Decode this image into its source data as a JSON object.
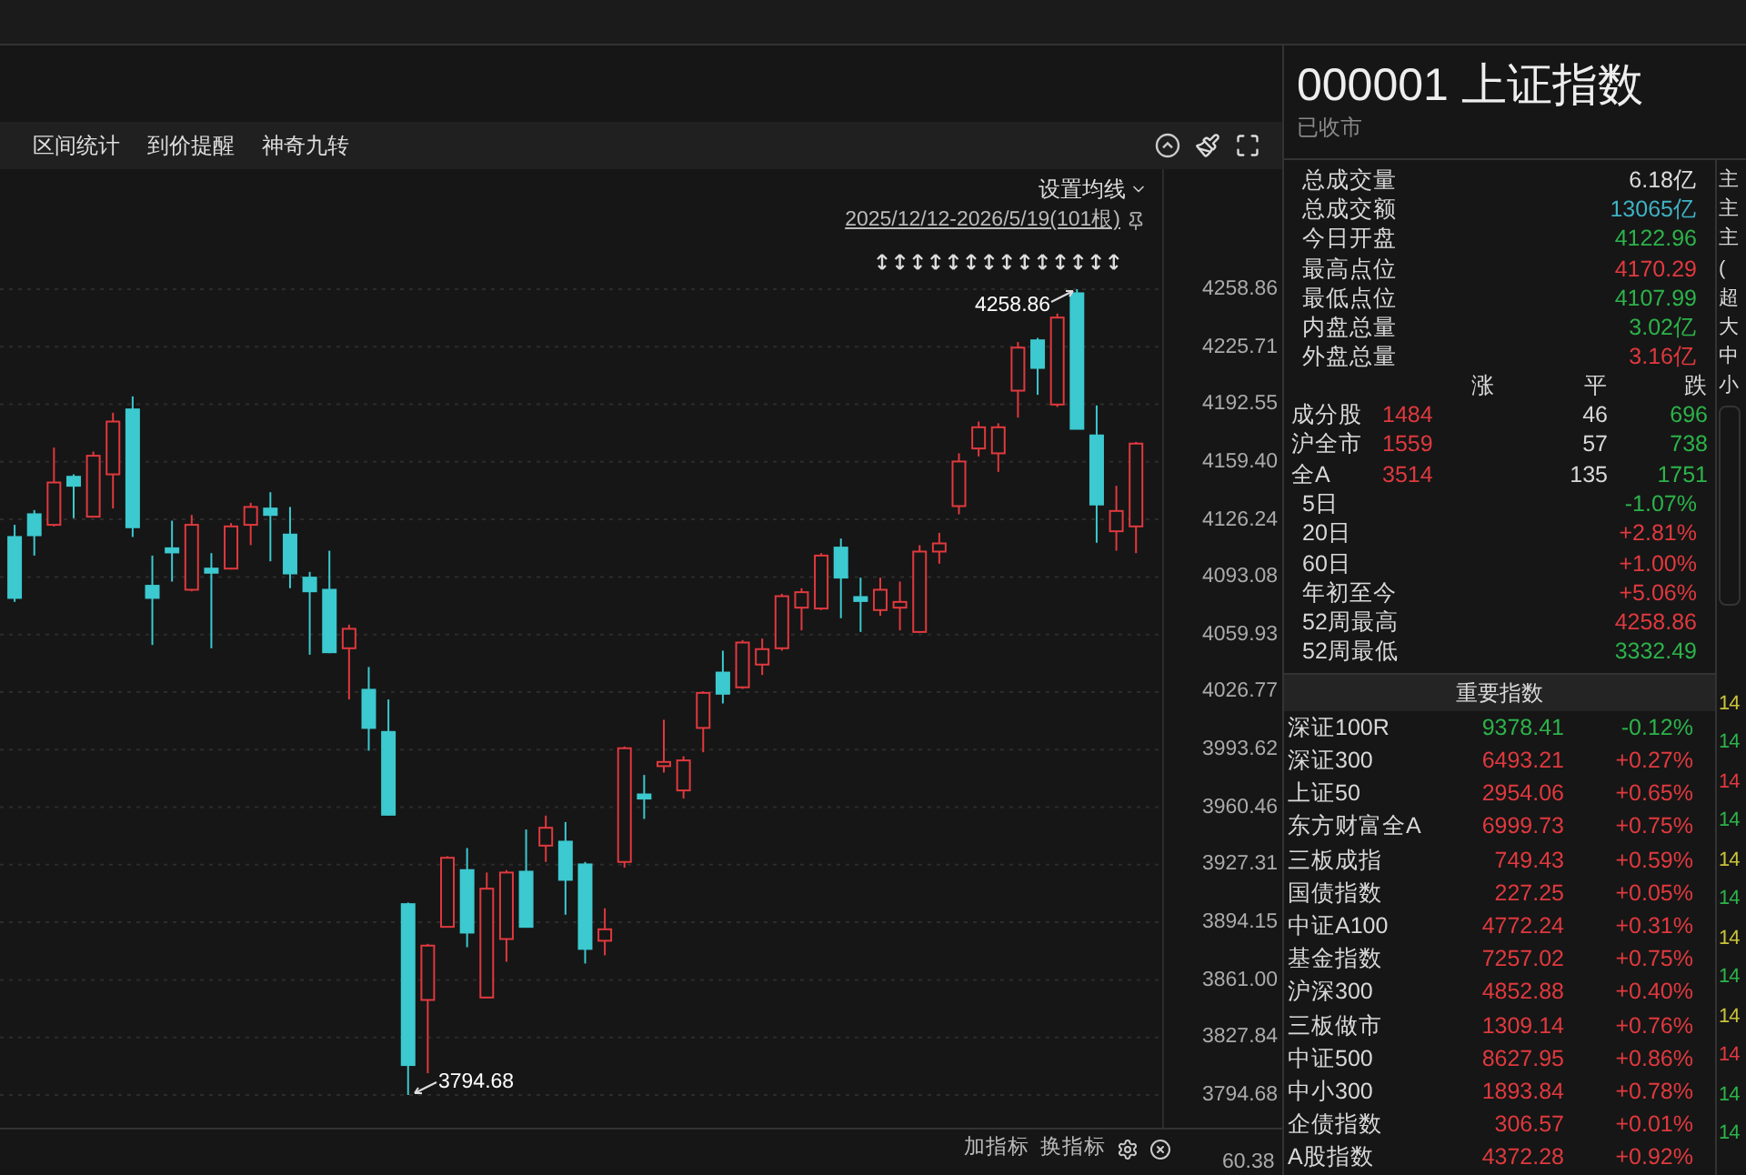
{
  "toolbar": {
    "items": [
      "区间统计",
      "到价提醒",
      "神奇九转"
    ]
  },
  "chart": {
    "ma_setting": "设置均线",
    "date_range": "2025/12/12-2026/5/19(101根)",
    "high_label": "4258.86",
    "low_label": "3794.68",
    "chart_data": {
      "type": "candlestick",
      "ylim": [
        3775.8,
        4328.0
      ],
      "grid": true,
      "yticks": [
        {
          "value": 4258.86,
          "label": "4258.86"
        },
        {
          "value": 4225.71,
          "label": "4225.71"
        },
        {
          "value": 4192.55,
          "label": "4192.55"
        },
        {
          "value": 4159.4,
          "label": "4159.40"
        },
        {
          "value": 4126.24,
          "label": "4126.24"
        },
        {
          "value": 4093.08,
          "label": "4093.08"
        },
        {
          "value": 4059.93,
          "label": "4059.93"
        },
        {
          "value": 4026.77,
          "label": "4026.77"
        },
        {
          "value": 3993.62,
          "label": "3993.62"
        },
        {
          "value": 3960.46,
          "label": "3960.46"
        },
        {
          "value": 3927.31,
          "label": "3927.31"
        },
        {
          "value": 3894.15,
          "label": "3894.15"
        },
        {
          "value": 3861.0,
          "label": "3861.00"
        },
        {
          "value": 3827.84,
          "label": "3827.84"
        },
        {
          "value": 3794.68,
          "label": "3794.68"
        }
      ],
      "ohlc": [
        [
          4116.1,
          4123.1,
          4078.7,
          4081.0
        ],
        [
          4129.2,
          4131.6,
          4105.4,
          4117.1
        ],
        [
          4123.1,
          4167.6,
          4122.2,
          4147.5
        ],
        [
          4150.8,
          4152.2,
          4126.9,
          4145.6
        ],
        [
          4127.8,
          4165.3,
          4127.8,
          4162.9
        ],
        [
          4152.2,
          4187.7,
          4132.5,
          4182.6
        ],
        [
          4189.6,
          4197.1,
          4116.1,
          4121.7
        ],
        [
          4088.0,
          4105.4,
          4053.9,
          4081.0
        ],
        [
          4109.6,
          4125.5,
          4090.4,
          4107.2
        ],
        [
          4085.7,
          4128.8,
          4084.8,
          4123.1
        ],
        [
          4097.9,
          4106.8,
          4052.0,
          4095.5
        ],
        [
          4097.9,
          4124.1,
          4097.4,
          4122.2
        ],
        [
          4123.1,
          4135.8,
          4111.4,
          4133.4
        ],
        [
          4132.5,
          4141.9,
          4102.1,
          4128.8
        ],
        [
          4117.5,
          4133.4,
          4086.6,
          4095.1
        ],
        [
          4092.7,
          4096.0,
          4048.3,
          4084.8
        ],
        [
          4085.7,
          4108.2,
          4049.2,
          4049.7
        ],
        [
          4052.0,
          4065.6,
          4022.5,
          4063.2
        ],
        [
          4028.1,
          4041.2,
          3993.0,
          4006.1
        ],
        [
          4003.8,
          4022.5,
          3955.6,
          3956.1
        ],
        [
          3904.6,
          3905.5,
          3794.68,
          3811.9
        ],
        [
          3849.4,
          3881.7,
          3807.2,
          3880.7
        ],
        [
          3891.5,
          3932.2,
          3891.5,
          3931.3
        ],
        [
          3924.2,
          3936.9,
          3879.8,
          3888.2
        ],
        [
          3850.8,
          3922.8,
          3850.8,
          3913.5
        ],
        [
          3884.5,
          3924.2,
          3871.4,
          3922.8
        ],
        [
          3923.3,
          3947.6,
          3891.5,
          3891.5
        ],
        [
          3938.3,
          3955.6,
          3928.9,
          3948.6
        ],
        [
          3940.6,
          3951.9,
          3898.5,
          3918.6
        ],
        [
          3927.5,
          3928.9,
          3870.4,
          3878.8
        ],
        [
          3883.5,
          3902.2,
          3875.1,
          3890.1
        ],
        [
          3928.9,
          3995.4,
          3925.6,
          3994.4
        ],
        [
          3967.8,
          3979.0,
          3953.7,
          3965.4
        ],
        [
          3984.1,
          4010.8,
          3980.4,
          3986.5
        ],
        [
          3970.1,
          3989.8,
          3965.4,
          3987.4
        ],
        [
          4006.1,
          4027.2,
          3992.1,
          4026.3
        ],
        [
          4038.0,
          4050.6,
          4020.2,
          4025.8
        ],
        [
          4029.5,
          4056.7,
          4028.6,
          4055.3
        ],
        [
          4042.6,
          4057.6,
          4036.6,
          4051.5
        ],
        [
          4052.0,
          4083.4,
          4050.6,
          4082.0
        ],
        [
          4075.4,
          4086.6,
          4062.3,
          4084.3
        ],
        [
          4074.9,
          4106.8,
          4074.0,
          4105.4
        ],
        [
          4110.0,
          4115.2,
          4069.3,
          4092.7
        ],
        [
          4081.5,
          4092.7,
          4061.4,
          4079.2
        ],
        [
          4074.0,
          4092.7,
          4070.7,
          4085.7
        ],
        [
          4075.4,
          4090.4,
          4062.3,
          4078.7
        ],
        [
          4061.4,
          4111.4,
          4060.9,
          4107.7
        ],
        [
          4107.7,
          4118.5,
          4100.7,
          4112.4
        ],
        [
          4133.9,
          4164.3,
          4129.2,
          4159.6
        ],
        [
          4167.1,
          4182.6,
          4162.5,
          4179.3
        ],
        [
          4164.3,
          4181.6,
          4153.6,
          4179.3
        ],
        [
          4200.4,
          4228.4,
          4184.9,
          4225.2
        ],
        [
          4229.4,
          4230.8,
          4198.0,
          4213.5
        ],
        [
          4192.4,
          4244.8,
          4191.0,
          4242.5
        ],
        [
          4256.5,
          4258.86,
          4178.4,
          4178.4
        ],
        [
          4174.6,
          4191.9,
          4112.8,
          4134.8
        ],
        [
          4119.4,
          4145.6,
          4108.2,
          4131.1
        ],
        [
          4122.2,
          4170.9,
          4106.8,
          4169.9
        ]
      ]
    },
    "sub_axis_label": "60.38"
  },
  "indicator_bar": {
    "buttons": [
      "加指标",
      "换指标"
    ]
  },
  "quote": {
    "title": "000001 上证指数",
    "status": "已收市",
    "stats": [
      {
        "label": "总成交量",
        "value": "6.18亿",
        "color": "#dddddd"
      },
      {
        "label": "总成交额",
        "value": "13065亿",
        "color": "#3fb2c4"
      },
      {
        "label": "今日开盘",
        "value": "4122.96",
        "color": "#2cb34a"
      },
      {
        "label": "最高点位",
        "value": "4170.29",
        "color": "#e0393e"
      },
      {
        "label": "最低点位",
        "value": "4107.99",
        "color": "#2cb34a"
      },
      {
        "label": "内盘总量",
        "value": "3.02亿",
        "color": "#2cb34a"
      },
      {
        "label": "外盘总量",
        "value": "3.16亿",
        "color": "#e0393e"
      }
    ],
    "breadth_header": [
      "涨",
      "平",
      "跌"
    ],
    "breadth": [
      {
        "label": "成分股",
        "up": "1484",
        "flat": "46",
        "down": "696"
      },
      {
        "label": "沪全市",
        "up": "1559",
        "flat": "57",
        "down": "738"
      },
      {
        "label": "全A",
        "up": "3514",
        "flat": "135",
        "down": "1751"
      }
    ],
    "returns": [
      {
        "label": "5日",
        "value": "-1.07%",
        "color": "#2cb34a"
      },
      {
        "label": "20日",
        "value": "+2.81%",
        "color": "#e0393e"
      },
      {
        "label": "60日",
        "value": "+1.00%",
        "color": "#e0393e"
      },
      {
        "label": "年初至今",
        "value": "+5.06%",
        "color": "#e0393e"
      },
      {
        "label": "52周最高",
        "value": "4258.86",
        "color": "#e0393e"
      },
      {
        "label": "52周最低",
        "value": "3332.49",
        "color": "#2cb34a"
      }
    ]
  },
  "important_indices": {
    "title": "重要指数",
    "rows": [
      {
        "name": "深证100R",
        "price": "9378.41",
        "change": "-0.12%",
        "color": "#2cb34a"
      },
      {
        "name": "深证300",
        "price": "6493.21",
        "change": "+0.27%",
        "color": "#e0393e"
      },
      {
        "name": "上证50",
        "price": "2954.06",
        "change": "+0.65%",
        "color": "#e0393e"
      },
      {
        "name": "东方财富全A",
        "price": "6999.73",
        "change": "+0.75%",
        "color": "#e0393e"
      },
      {
        "name": "三板成指",
        "price": "749.43",
        "change": "+0.59%",
        "color": "#e0393e"
      },
      {
        "name": "国债指数",
        "price": "227.25",
        "change": "+0.05%",
        "color": "#e0393e"
      },
      {
        "name": "中证A100",
        "price": "4772.24",
        "change": "+0.31%",
        "color": "#e0393e"
      },
      {
        "name": "基金指数",
        "price": "7257.02",
        "change": "+0.75%",
        "color": "#e0393e"
      },
      {
        "name": "沪深300",
        "price": "4852.88",
        "change": "+0.40%",
        "color": "#e0393e"
      },
      {
        "name": "三板做市",
        "price": "1309.14",
        "change": "+0.76%",
        "color": "#e0393e"
      },
      {
        "name": "中证500",
        "price": "8627.95",
        "change": "+0.86%",
        "color": "#e0393e"
      },
      {
        "name": "中小300",
        "price": "1893.84",
        "change": "+0.78%",
        "color": "#e0393e"
      },
      {
        "name": "企债指数",
        "price": "306.57",
        "change": "+0.01%",
        "color": "#e0393e"
      },
      {
        "name": "A股指数",
        "price": "4372.28",
        "change": "+0.92%",
        "color": "#e0393e"
      }
    ]
  },
  "side_panel": {
    "labels": [
      "主",
      "主",
      "主",
      "(",
      "超",
      "大",
      "中",
      "小"
    ],
    "values": [
      {
        "text": "14",
        "color": "#c9c23a"
      },
      {
        "text": "14",
        "color": "#2cb34a"
      },
      {
        "text": "14",
        "color": "#e0393e"
      },
      {
        "text": "14",
        "color": "#2cb34a"
      },
      {
        "text": "14",
        "color": "#c9c23a"
      },
      {
        "text": "14",
        "color": "#2cb34a"
      },
      {
        "text": "14",
        "color": "#c9c23a"
      },
      {
        "text": "14",
        "color": "#2cb34a"
      },
      {
        "text": "14",
        "color": "#c9c23a"
      },
      {
        "text": "14",
        "color": "#e0393e"
      },
      {
        "text": "14",
        "color": "#2cb34a"
      },
      {
        "text": "14",
        "color": "#2cb34a"
      }
    ]
  }
}
